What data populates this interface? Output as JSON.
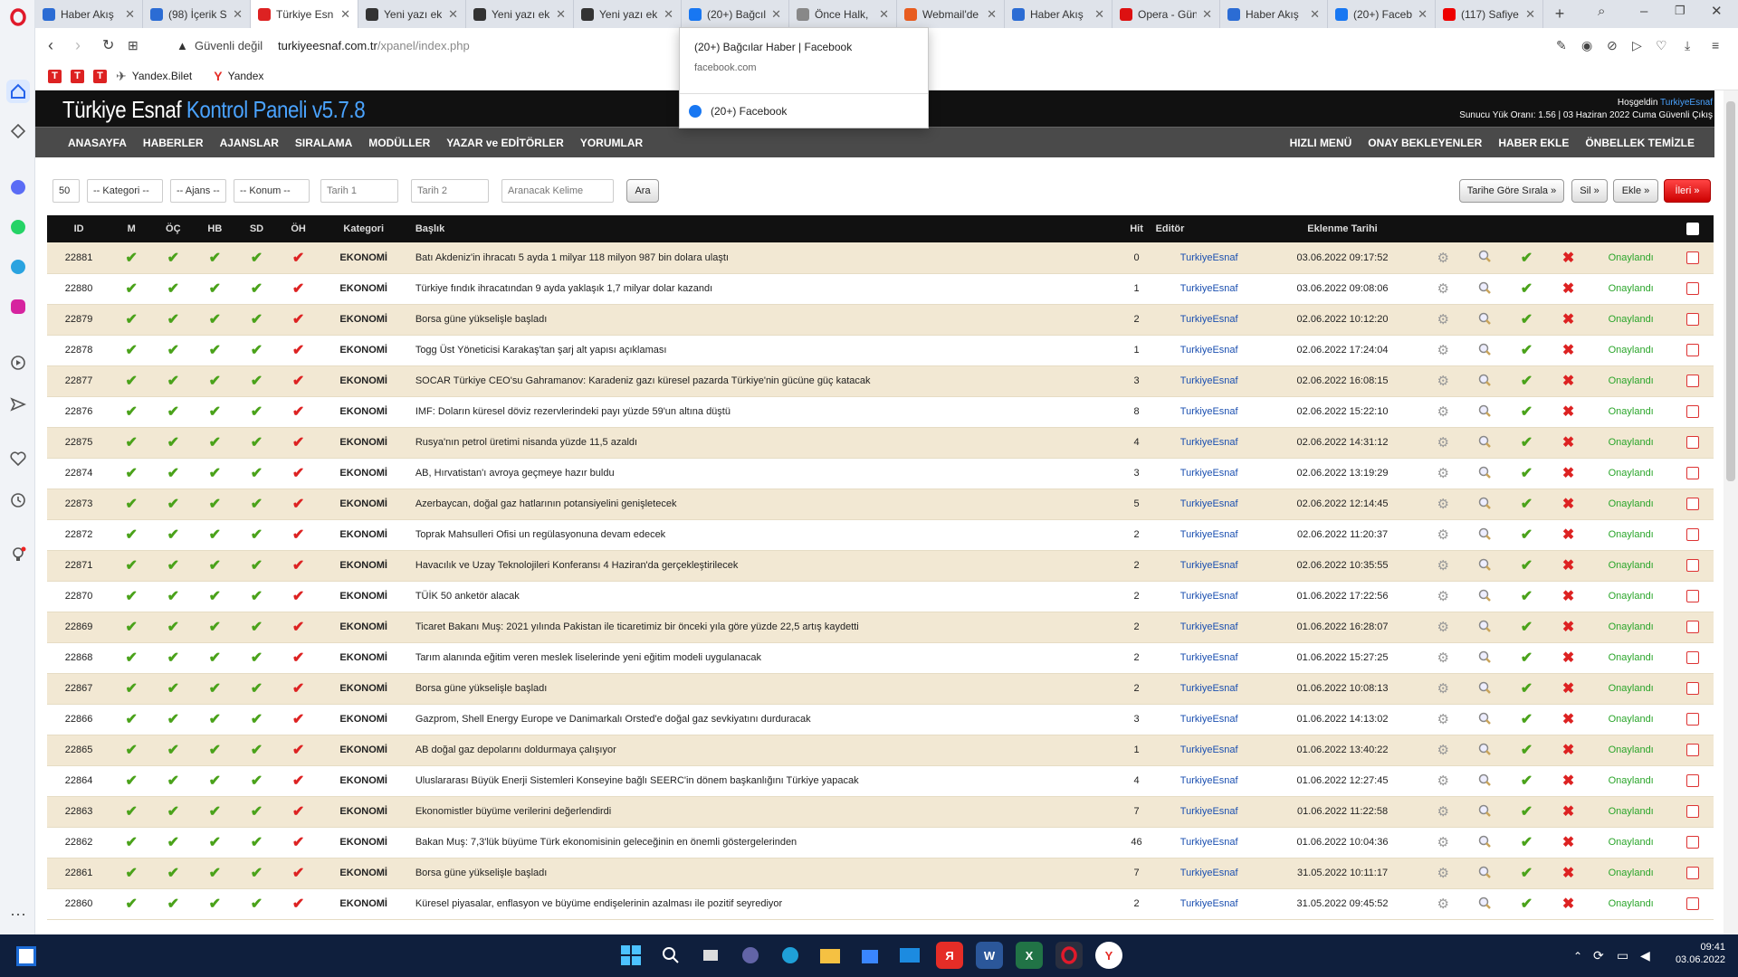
{
  "browser": {
    "tabs": [
      {
        "title": "Haber Akış",
        "fav": "globe",
        "color": "#2b6cd4"
      },
      {
        "title": "(98) İçerik S",
        "fav": "doc",
        "color": "#2b6cd4"
      },
      {
        "title": "Türkiye Esn",
        "fav": "T",
        "color": "#d22"
      },
      {
        "title": "Yeni yazı ek",
        "fav": "wp",
        "color": "#333"
      },
      {
        "title": "Yeni yazı ek",
        "fav": "wp",
        "color": "#333"
      },
      {
        "title": "Yeni yazı ek",
        "fav": "wp",
        "color": "#333"
      },
      {
        "title": "(20+) Bağcıl",
        "fav": "f",
        "color": "#1877f2"
      },
      {
        "title": "Önce Halk,",
        "fav": "w",
        "color": "#888"
      },
      {
        "title": "Webmail'de",
        "fav": "cp",
        "color": "#e85c1f"
      },
      {
        "title": "Haber Akış",
        "fav": "globe",
        "color": "#2b6cd4"
      },
      {
        "title": "Opera - Gün",
        "fav": "O",
        "color": "#d11"
      },
      {
        "title": "Haber Akış",
        "fav": "globe",
        "color": "#2b6cd4"
      },
      {
        "title": "(20+) Faceb",
        "fav": "f",
        "color": "#1877f2"
      },
      {
        "title": "(117) Safiye",
        "fav": "yt",
        "color": "#e00"
      }
    ],
    "new_tab": "+",
    "security_label": "Güvenli değil",
    "url_host": "turkiyeesnaf.com.tr",
    "url_path": "/xpanel/index.php",
    "bookmarks": [
      {
        "label": "",
        "icon": "T"
      },
      {
        "label": "",
        "icon": "T"
      },
      {
        "label": "",
        "icon": "T"
      },
      {
        "label": "Yandex.Bilet",
        "icon": "plane"
      },
      {
        "label": "Yandex",
        "icon": "Y"
      }
    ],
    "popup": {
      "title": "(20+) Bağcılar Haber | Facebook",
      "domain": "facebook.com",
      "item": "(20+) Facebook"
    }
  },
  "panel": {
    "brand_white": "Türkiye Esnaf",
    "brand_blue": "Kontrol Paneli v5.7.8",
    "welcome": "Hoşgeldin",
    "user": "TurkiyeEsnaf",
    "server_line": "Sunucu Yük Oranı: 1.56 | 03 Haziran 2022 Cuma Güvenli Çıkış",
    "nav_left": [
      "ANASAYFA",
      "HABERLER",
      "AJANSLAR",
      "SIRALAMA",
      "MODÜLLER",
      "YAZAR ve EDİTÖRLER",
      "YORUMLAR"
    ],
    "nav_right": [
      "HIZLI MENÜ",
      "ONAY BEKLEYENLER",
      "HABER EKLE",
      "ÖNBELLEK TEMİZLE"
    ]
  },
  "filters": {
    "limit": "50",
    "category": "-- Kategori --",
    "agency": "-- Ajans --",
    "position": "-- Konum --",
    "date1": "Tarih 1",
    "date2": "Tarih 2",
    "keyword": "Aranacak Kelime",
    "search_btn": "Ara",
    "sort_btn": "Tarihe Göre Sırala »",
    "delete_btn": "Sil »",
    "add_btn": "Ekle »",
    "next_btn": "İleri »"
  },
  "table": {
    "headers": {
      "id": "ID",
      "m": "M",
      "oc": "ÖÇ",
      "hb": "HB",
      "sd": "SD",
      "oh": "ÖH",
      "cat": "Kategori",
      "title": "Başlık",
      "hit": "Hit",
      "editor": "Editör",
      "date": "Eklenme Tarihi"
    },
    "rows": [
      {
        "id": "22881",
        "cat": "EKONOMİ",
        "title": "Batı Akdeniz'in ihracatı 5 ayda 1 milyar 118 milyon 987 bin dolara ulaştı",
        "hit": "0",
        "editor": "TurkiyeEsnaf",
        "date": "03.06.2022 09:17:52",
        "status": "Onaylandı"
      },
      {
        "id": "22880",
        "cat": "EKONOMİ",
        "title": "Türkiye fındık ihracatından 9 ayda yaklaşık 1,7 milyar dolar kazandı",
        "hit": "1",
        "editor": "TurkiyeEsnaf",
        "date": "03.06.2022 09:08:06",
        "status": "Onaylandı"
      },
      {
        "id": "22879",
        "cat": "EKONOMİ",
        "title": "Borsa güne yükselişle başladı",
        "hit": "2",
        "editor": "TurkiyeEsnaf",
        "date": "02.06.2022 10:12:20",
        "status": "Onaylandı"
      },
      {
        "id": "22878",
        "cat": "EKONOMİ",
        "title": "Togg Üst Yöneticisi Karakaş'tan şarj alt yapısı açıklaması",
        "hit": "1",
        "editor": "TurkiyeEsnaf",
        "date": "02.06.2022 17:24:04",
        "status": "Onaylandı"
      },
      {
        "id": "22877",
        "cat": "EKONOMİ",
        "title": "SOCAR Türkiye CEO'su Gahramanov: Karadeniz gazı küresel pazarda Türkiye'nin gücüne güç katacak",
        "hit": "3",
        "editor": "TurkiyeEsnaf",
        "date": "02.06.2022 16:08:15",
        "status": "Onaylandı"
      },
      {
        "id": "22876",
        "cat": "EKONOMİ",
        "title": "IMF: Doların küresel döviz rezervlerindeki payı yüzde 59'un altına düştü",
        "hit": "8",
        "editor": "TurkiyeEsnaf",
        "date": "02.06.2022 15:22:10",
        "status": "Onaylandı"
      },
      {
        "id": "22875",
        "cat": "EKONOMİ",
        "title": "Rusya'nın petrol üretimi nisanda yüzde 11,5 azaldı",
        "hit": "4",
        "editor": "TurkiyeEsnaf",
        "date": "02.06.2022 14:31:12",
        "status": "Onaylandı"
      },
      {
        "id": "22874",
        "cat": "EKONOMİ",
        "title": "AB, Hırvatistan'ı avroya geçmeye hazır buldu",
        "hit": "3",
        "editor": "TurkiyeEsnaf",
        "date": "02.06.2022 13:19:29",
        "status": "Onaylandı"
      },
      {
        "id": "22873",
        "cat": "EKONOMİ",
        "title": "Azerbaycan, doğal gaz hatlarının potansiyelini genişletecek",
        "hit": "5",
        "editor": "TurkiyeEsnaf",
        "date": "02.06.2022 12:14:45",
        "status": "Onaylandı"
      },
      {
        "id": "22872",
        "cat": "EKONOMİ",
        "title": "Toprak Mahsulleri Ofisi un regülasyonuna devam edecek",
        "hit": "2",
        "editor": "TurkiyeEsnaf",
        "date": "02.06.2022 11:20:37",
        "status": "Onaylandı"
      },
      {
        "id": "22871",
        "cat": "EKONOMİ",
        "title": "Havacılık ve Uzay Teknolojileri Konferansı 4 Haziran'da gerçekleştirilecek",
        "hit": "2",
        "editor": "TurkiyeEsnaf",
        "date": "02.06.2022 10:35:55",
        "status": "Onaylandı"
      },
      {
        "id": "22870",
        "cat": "EKONOMİ",
        "title": "TÜİK 50 anketör alacak",
        "hit": "2",
        "editor": "TurkiyeEsnaf",
        "date": "01.06.2022 17:22:56",
        "status": "Onaylandı"
      },
      {
        "id": "22869",
        "cat": "EKONOMİ",
        "title": "Ticaret Bakanı Muş: 2021 yılında Pakistan ile ticaretimiz bir önceki yıla göre yüzde 22,5 artış kaydetti",
        "hit": "2",
        "editor": "TurkiyeEsnaf",
        "date": "01.06.2022 16:28:07",
        "status": "Onaylandı"
      },
      {
        "id": "22868",
        "cat": "EKONOMİ",
        "title": "Tarım alanında eğitim veren meslek liselerinde yeni eğitim modeli uygulanacak",
        "hit": "2",
        "editor": "TurkiyeEsnaf",
        "date": "01.06.2022 15:27:25",
        "status": "Onaylandı"
      },
      {
        "id": "22867",
        "cat": "EKONOMİ",
        "title": "Borsa güne yükselişle başladı",
        "hit": "2",
        "editor": "TurkiyeEsnaf",
        "date": "01.06.2022 10:08:13",
        "status": "Onaylandı"
      },
      {
        "id": "22866",
        "cat": "EKONOMİ",
        "title": "Gazprom, Shell Energy Europe ve Danimarkalı Orsted'e doğal gaz sevkiyatını durduracak",
        "hit": "3",
        "editor": "TurkiyeEsnaf",
        "date": "01.06.2022 14:13:02",
        "status": "Onaylandı"
      },
      {
        "id": "22865",
        "cat": "EKONOMİ",
        "title": "AB doğal gaz depolarını doldurmaya çalışıyor",
        "hit": "1",
        "editor": "TurkiyeEsnaf",
        "date": "01.06.2022 13:40:22",
        "status": "Onaylandı"
      },
      {
        "id": "22864",
        "cat": "EKONOMİ",
        "title": "Uluslararası Büyük Enerji Sistemleri Konseyine bağlı SEERC'in dönem başkanlığını Türkiye yapacak",
        "hit": "4",
        "editor": "TurkiyeEsnaf",
        "date": "01.06.2022 12:27:45",
        "status": "Onaylandı"
      },
      {
        "id": "22863",
        "cat": "EKONOMİ",
        "title": "Ekonomistler büyüme verilerini değerlendirdi",
        "hit": "7",
        "editor": "TurkiyeEsnaf",
        "date": "01.06.2022 11:22:58",
        "status": "Onaylandı"
      },
      {
        "id": "22862",
        "cat": "EKONOMİ",
        "title": "Bakan Muş: 7,3'lük büyüme Türk ekonomisinin geleceğinin en önemli göstergelerinden",
        "hit": "46",
        "editor": "TurkiyeEsnaf",
        "date": "01.06.2022 10:04:36",
        "status": "Onaylandı"
      },
      {
        "id": "22861",
        "cat": "EKONOMİ",
        "title": "Borsa güne yükselişle başladı",
        "hit": "7",
        "editor": "TurkiyeEsnaf",
        "date": "31.05.2022 10:11:17",
        "status": "Onaylandı"
      },
      {
        "id": "22860",
        "cat": "EKONOMİ",
        "title": "Küresel piyasalar, enflasyon ve büyüme endişelerinin azalması ile pozitif seyrediyor",
        "hit": "2",
        "editor": "TurkiyeEsnaf",
        "date": "31.05.2022 09:45:52",
        "status": "Onaylandı"
      }
    ]
  },
  "taskbar": {
    "time": "09:41",
    "date": "03.06.2022"
  }
}
